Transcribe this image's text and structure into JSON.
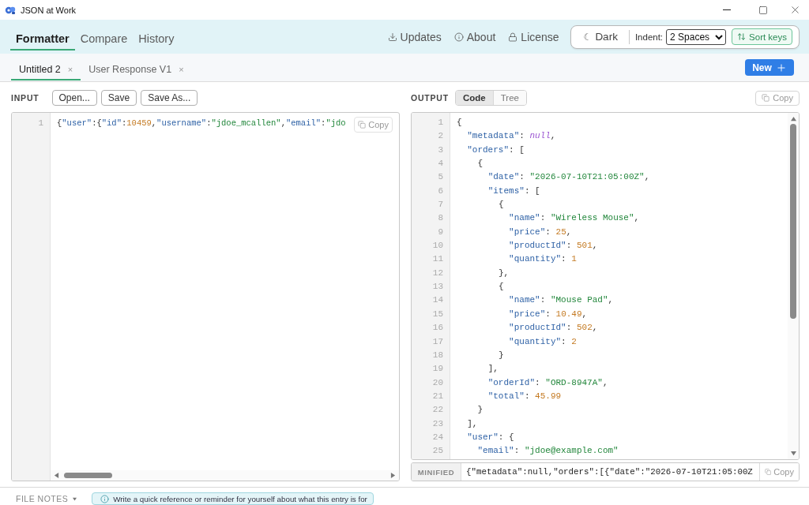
{
  "window": {
    "title": "JSON at Work"
  },
  "nav": {
    "tabs": [
      {
        "label": "Formatter",
        "selected": true
      },
      {
        "label": "Compare",
        "selected": false
      },
      {
        "label": "History",
        "selected": false
      }
    ],
    "links": [
      {
        "kind": "download",
        "label": "Updates"
      },
      {
        "kind": "info",
        "label": "About"
      },
      {
        "kind": "lock",
        "label": "License"
      }
    ]
  },
  "settings": {
    "theme": {
      "icon": "☾",
      "label": "Dark"
    },
    "indent": {
      "label": "Indent:",
      "value": "2 Spaces"
    },
    "sort_keys": {
      "label": "Sort keys"
    }
  },
  "file_tabs": {
    "tabs": [
      {
        "label": "Untitled 2",
        "close": "×",
        "selected": true
      },
      {
        "label": "User Response V1",
        "close": "×",
        "selected": false
      }
    ],
    "new_button": {
      "label": "New"
    }
  },
  "input": {
    "label": "INPUT",
    "buttons": [
      "Open...",
      "Save",
      "Save As..."
    ],
    "copy_button": "Copy",
    "lines": [
      {
        "number": "1",
        "code": "{\"user\":{\"id\":10459,\"username\":\"jdoe_mcallen\",\"email\":\"jdo"
      }
    ]
  },
  "output": {
    "label": "OUTPUT",
    "views": [
      {
        "label": "Code",
        "selected": true
      },
      {
        "label": "Tree",
        "selected": false
      }
    ],
    "copy_button": "Copy",
    "lines": [
      {
        "number": "1",
        "code": "{"
      },
      {
        "number": "2",
        "code": "  \"metadata\": null,"
      },
      {
        "number": "3",
        "code": "  \"orders\": ["
      },
      {
        "number": "4",
        "code": "    {"
      },
      {
        "number": "5",
        "code": "      \"date\": \"2026-07-10T21:05:00Z\","
      },
      {
        "number": "6",
        "code": "      \"items\": ["
      },
      {
        "number": "7",
        "code": "        {"
      },
      {
        "number": "8",
        "code": "          \"name\": \"Wireless Mouse\","
      },
      {
        "number": "9",
        "code": "          \"price\": 25,"
      },
      {
        "number": "10",
        "code": "          \"productId\": 501,"
      },
      {
        "number": "11",
        "code": "          \"quantity\": 1"
      },
      {
        "number": "12",
        "code": "        },"
      },
      {
        "number": "13",
        "code": "        {"
      },
      {
        "number": "14",
        "code": "          \"name\": \"Mouse Pad\","
      },
      {
        "number": "15",
        "code": "          \"price\": 10.49,"
      },
      {
        "number": "16",
        "code": "          \"productId\": 502,"
      },
      {
        "number": "17",
        "code": "          \"quantity\": 2"
      },
      {
        "number": "18",
        "code": "        }"
      },
      {
        "number": "19",
        "code": "      ],"
      },
      {
        "number": "20",
        "code": "      \"orderId\": \"ORD-8947A\","
      },
      {
        "number": "21",
        "code": "      \"total\": 45.99"
      },
      {
        "number": "22",
        "code": "    }"
      },
      {
        "number": "23",
        "code": "  ],"
      },
      {
        "number": "24",
        "code": "  \"user\": {"
      },
      {
        "number": "25",
        "code": "    \"email\": \"jdoe@example.com\""
      }
    ],
    "minified": {
      "label": "MINIFIED",
      "text": "{\"metadata\":null,\"orders\":[{\"date\":\"2026-07-10T21:05:00Z",
      "copy_button": "Copy"
    }
  },
  "file_notes": {
    "label": "FILE NOTES",
    "hint": "Write a quick reference or reminder for yourself about what this entry is for"
  }
}
